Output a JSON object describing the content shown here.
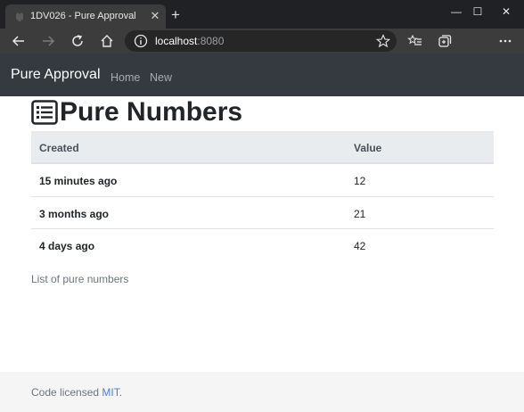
{
  "browser": {
    "tab_title": "1DV026 - Pure Approval",
    "url_host": "localhost",
    "url_port": ":8080",
    "icons": [
      "back-icon",
      "forward-icon",
      "refresh-icon",
      "home-icon",
      "info-icon",
      "star-icon",
      "favorites-icon",
      "collections-icon"
    ]
  },
  "navbar": {
    "brand": "Pure Approval",
    "links": [
      "Home",
      "New"
    ]
  },
  "page": {
    "title": "Pure Numbers",
    "table": {
      "headers": [
        "Created",
        "Value"
      ],
      "rows": [
        {
          "created": "15 minutes ago",
          "value": "12"
        },
        {
          "created": "3 months ago",
          "value": "21"
        },
        {
          "created": "4 days ago",
          "value": "42"
        }
      ]
    },
    "caption": "List of pure numbers"
  },
  "footer": {
    "text": "Code licensed ",
    "link": "MIT",
    "suffix": "."
  },
  "colors": {
    "navbar_bg": "#343a40",
    "table_header_bg": "#e9ecef",
    "footer_bg": "#f5f5f5",
    "link": "#4f7ec9"
  }
}
